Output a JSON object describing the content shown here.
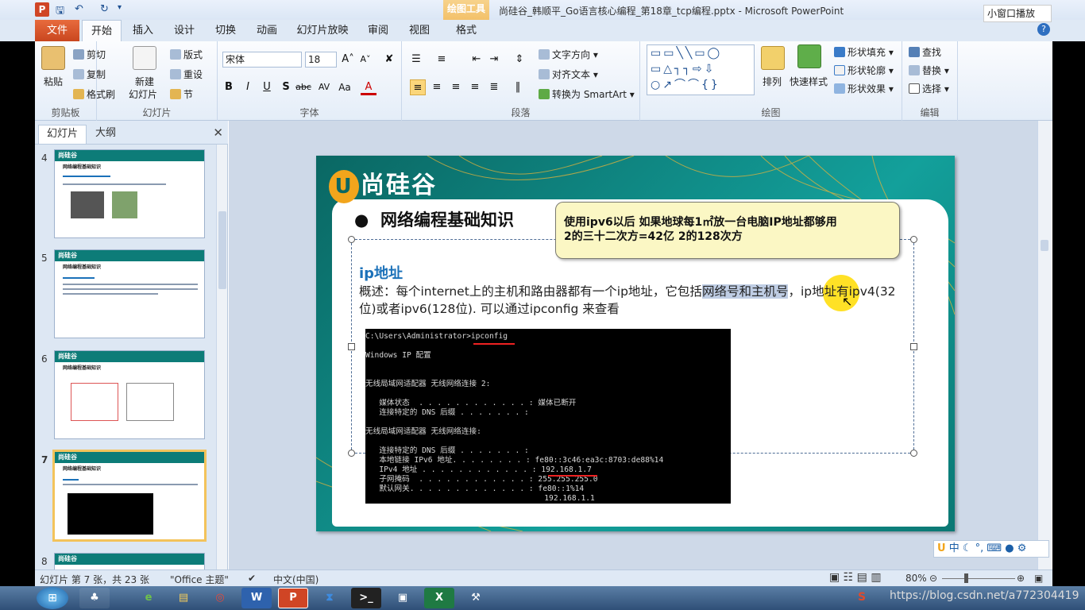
{
  "window": {
    "title": "尚硅谷_韩顺平_Go语言核心编程_第18章_tcp编程.pptx - Microsoft PowerPoint",
    "contextual_tab": "绘图工具",
    "mini_play": "小窗口播放"
  },
  "tabs": [
    "文件",
    "开始",
    "插入",
    "设计",
    "切换",
    "动画",
    "幻灯片放映",
    "审阅",
    "视图",
    "格式"
  ],
  "active_tab": "开始",
  "ribbon": {
    "clipboard": {
      "label": "剪贴板",
      "paste": "粘贴",
      "cut": "剪切",
      "copy": "复制",
      "painter": "格式刷"
    },
    "slides": {
      "label": "幻灯片",
      "new_slide": "新建",
      "new_slide2": "幻灯片",
      "layout": "版式",
      "reset": "重设",
      "section": "节"
    },
    "font": {
      "label": "字体",
      "name": "宋体",
      "size": "18"
    },
    "paragraph": {
      "label": "段落",
      "text_direction": "文字方向",
      "align_text": "对齐文本",
      "smartart": "转换为 SmartArt"
    },
    "drawing": {
      "label": "绘图",
      "arrange": "排列",
      "quick_styles": "快速样式",
      "fill": "形状填充",
      "outline": "形状轮廓",
      "effects": "形状效果"
    },
    "editing": {
      "label": "编辑",
      "find": "查找",
      "replace": "替换",
      "select": "选择"
    }
  },
  "panel": {
    "tabs": [
      "幻灯片",
      "大纲"
    ],
    "thumbnails": [
      {
        "num": "4",
        "title": "网络编程基础知识"
      },
      {
        "num": "5",
        "title": "网络编程基础知识"
      },
      {
        "num": "6",
        "title": "网络编程基础知识"
      },
      {
        "num": "7",
        "title": "网络编程基础知识"
      },
      {
        "num": "8",
        "title": ""
      }
    ]
  },
  "slide": {
    "logo": "尚硅谷",
    "bullet_title": "网络编程基础知识",
    "callout_line1": "使用ipv6以后  如果地球每1㎡放一台电脑IP地址都够用",
    "callout_line2": "2的三十二次方=42亿  2的128次方",
    "subtitle": "ip地址",
    "para_part1": "概述：每个internet上的主机和路由器都有一个ip地址，它包括",
    "para_highlight": "网络号和主机号",
    "para_part2": "，ip地址有ipv4(32位)或者ipv6(128位). 可以通过ipconfig 来查看",
    "cmd_lines": [
      "C:\\Users\\Administrator>ipconfig",
      "",
      "Windows IP 配置",
      "",
      "",
      "无线局域网适配器 无线网络连接 2:",
      "",
      "   媒体状态  . . . . . . . . . . . . : 媒体已断开",
      "   连接特定的 DNS 后缀 . . . . . . . :",
      "",
      "无线局域网适配器 无线网络连接:",
      "",
      "   连接特定的 DNS 后缀 . . . . . . . :",
      "   本地链接 IPv6 地址. . . . . . . . : fe80::3c46:ea3c:8703:de88%14",
      "   IPv4 地址 . . . . . . . . . . . . : 192.168.1.7",
      "   子网掩码  . . . . . . . . . . . . : 255.255.255.0",
      "   默认网关. . . . . . . . . . . . . : fe80::1%14",
      "                                       192.168.1.1"
    ]
  },
  "status": {
    "slide_info": "幻灯片 第 7 张，共 23 张",
    "theme": "\"Office 主题\"",
    "language": "中文(中国)",
    "zoom": "80%"
  },
  "ime": "中",
  "watermark": "https://blog.csdn.net/a772304419"
}
